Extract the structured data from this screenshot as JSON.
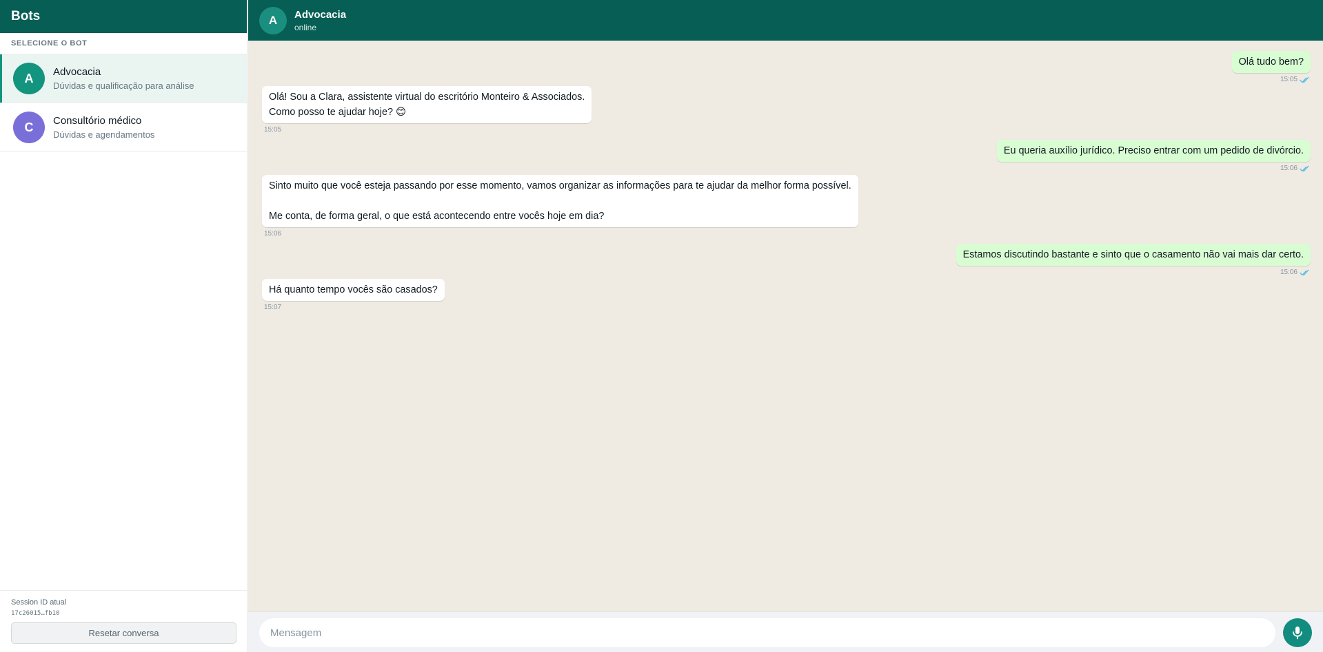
{
  "sidebar": {
    "title": "Bots",
    "section_label": "SELECIONE O BOT",
    "bots": [
      {
        "initial": "A",
        "name": "Advocacia",
        "description": "Dúvidas e qualificação para análise",
        "color": "#13947f",
        "active": true
      },
      {
        "initial": "C",
        "name": "Consultório médico",
        "description": "Dúvidas e agendamentos",
        "color": "#7a6fd8",
        "active": false
      }
    ],
    "footer": {
      "session_label": "Session ID atual",
      "session_id": "17c26015…fb10",
      "reset_label": "Resetar conversa"
    }
  },
  "chat": {
    "header": {
      "initial": "A",
      "title": "Advocacia",
      "status": "online"
    },
    "messages": [
      {
        "direction": "out",
        "text": "Olá tudo bem?",
        "time": "15:05"
      },
      {
        "direction": "in",
        "text": "Olá! Sou a Clara, assistente virtual do escritório Monteiro & Associados.\nComo posso te ajudar hoje? 😊",
        "time": "15:05"
      },
      {
        "direction": "out",
        "text": "Eu queria auxílio jurídico. Preciso entrar com um pedido de divórcio.",
        "time": "15:06"
      },
      {
        "direction": "in",
        "text": "Sinto muito que você esteja passando por esse momento, vamos organizar as informações para te ajudar da melhor forma possível.\n\nMe conta, de forma geral, o que está acontecendo entre vocês hoje em dia?",
        "time": "15:06"
      },
      {
        "direction": "out",
        "text": "Estamos discutindo bastante e sinto que o casamento não vai mais dar certo.",
        "time": "15:06"
      },
      {
        "direction": "in",
        "text": "Há quanto tempo vocês são casados?",
        "time": "15:07"
      }
    ],
    "composer": {
      "placeholder": "Mensagem"
    }
  },
  "colors": {
    "header_bg": "#075e54",
    "chat_bg": "#efeae2",
    "outgoing_bubble": "#d9fdd3",
    "incoming_bubble": "#ffffff",
    "accent": "#128c7e",
    "read_tick": "#53bdeb"
  },
  "icons": {
    "read_receipt": "double-check-icon",
    "mic": "microphone-icon"
  }
}
